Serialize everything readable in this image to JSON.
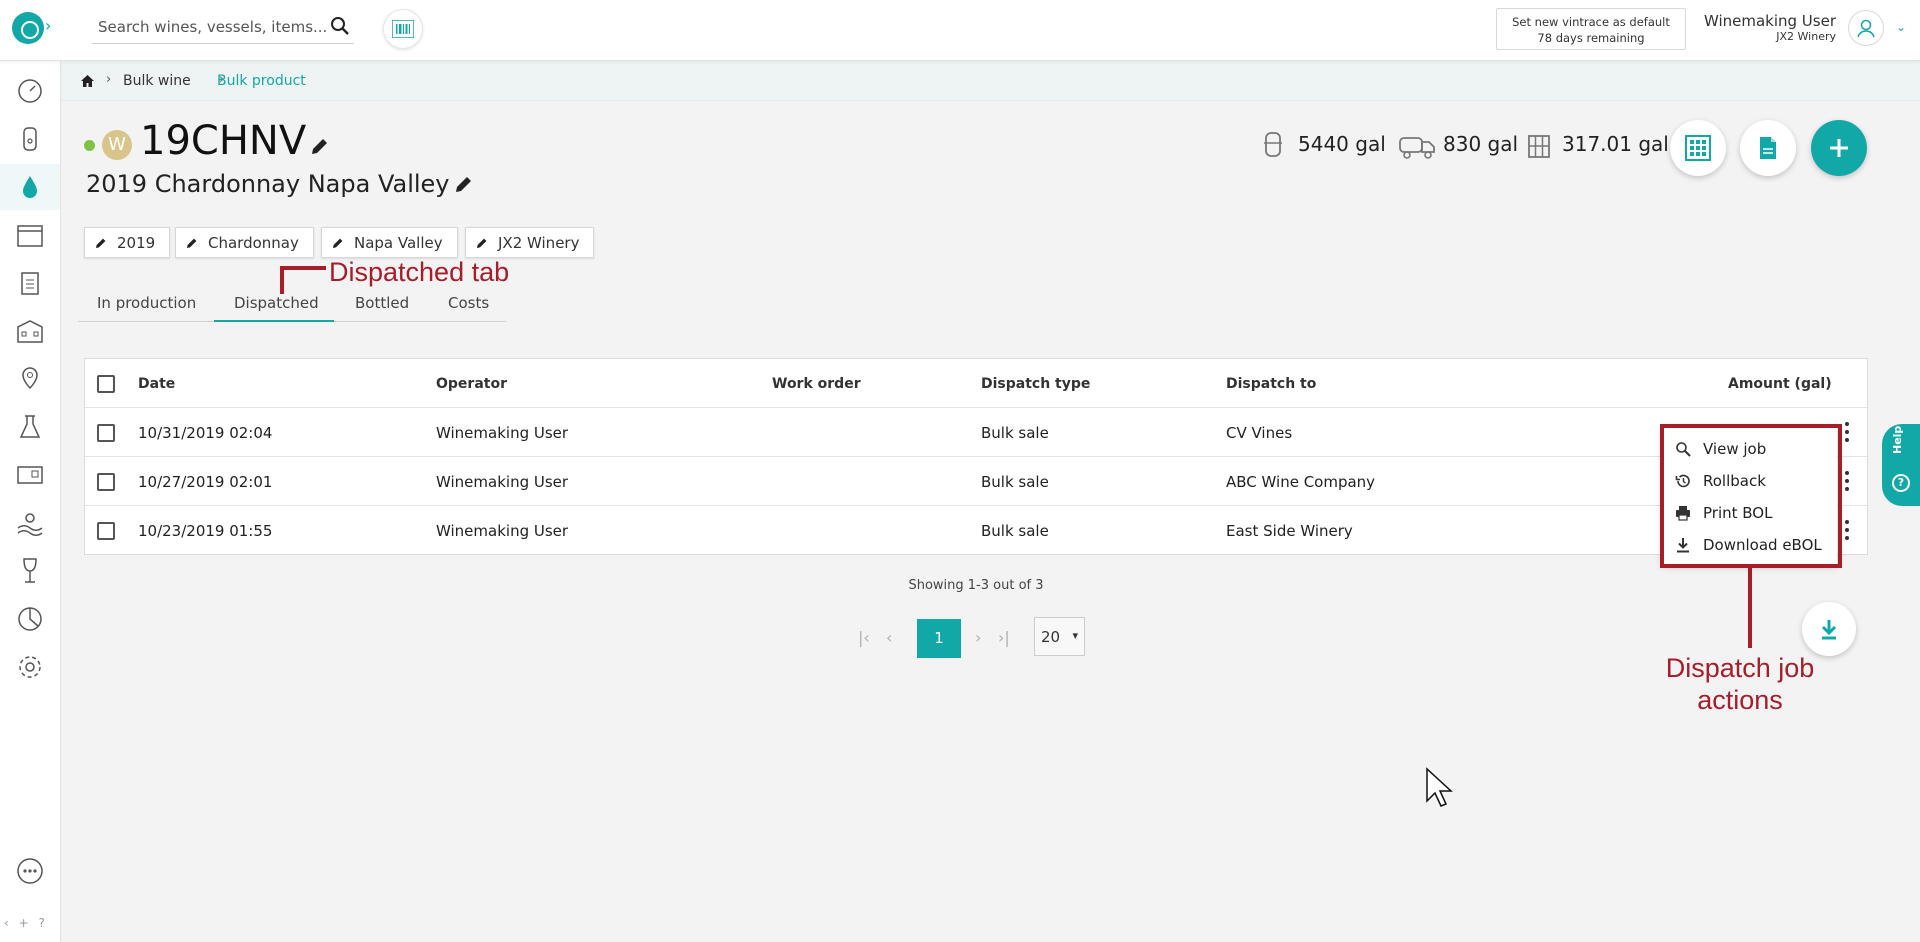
{
  "app": {
    "accent": "#13a8a8",
    "annotation_color": "#a71d2a"
  },
  "search": {
    "placeholder": "Search wines, vessels, items..."
  },
  "vintrace_notice": {
    "line1": "Set new vintrace as default",
    "line2": "78 days remaining"
  },
  "user": {
    "name": "Winemaking User",
    "winery": "JX2 Winery"
  },
  "breadcrumb": {
    "items": [
      "Bulk wine",
      "Bulk product"
    ]
  },
  "product": {
    "status_color": "#7dc242",
    "badge": "W",
    "code": "19CHNV",
    "name": "2019 Chardonnay Napa Valley",
    "metrics": [
      {
        "icon": "tank-icon",
        "value": "5440 gal"
      },
      {
        "icon": "truck-icon",
        "value": "830 gal"
      },
      {
        "icon": "bottles-icon",
        "value": "317.01 gal"
      }
    ],
    "tags": [
      "2019",
      "Chardonnay",
      "Napa Valley",
      "JX2 Winery"
    ]
  },
  "tabs": {
    "items": [
      "In production",
      "Dispatched",
      "Bottled",
      "Costs"
    ],
    "active": "Dispatched"
  },
  "table": {
    "columns": [
      "Date",
      "Operator",
      "Work order",
      "Dispatch type",
      "Dispatch to",
      "Amount (gal)"
    ],
    "rows": [
      {
        "date": "10/31/2019 02:04",
        "operator": "Winemaking User",
        "work_order": "",
        "dispatch_type": "Bulk sale",
        "dispatch_to": "CV Vines",
        "amount": ""
      },
      {
        "date": "10/27/2019 02:01",
        "operator": "Winemaking User",
        "work_order": "",
        "dispatch_type": "Bulk sale",
        "dispatch_to": "ABC Wine Company",
        "amount": ""
      },
      {
        "date": "10/23/2019 01:55",
        "operator": "Winemaking User",
        "work_order": "",
        "dispatch_type": "Bulk sale",
        "dispatch_to": "East Side Winery",
        "amount": ""
      }
    ]
  },
  "action_menu": {
    "items": [
      "View job",
      "Rollback",
      "Print BOL",
      "Download eBOL"
    ]
  },
  "pagination": {
    "showing": "Showing 1-3 out of 3",
    "current_page": "1",
    "page_size": "20"
  },
  "help": {
    "label": "Help"
  },
  "annotations": {
    "tab_label": "Dispatched tab",
    "menu_label_line1": "Dispatch job",
    "menu_label_line2": "actions"
  }
}
